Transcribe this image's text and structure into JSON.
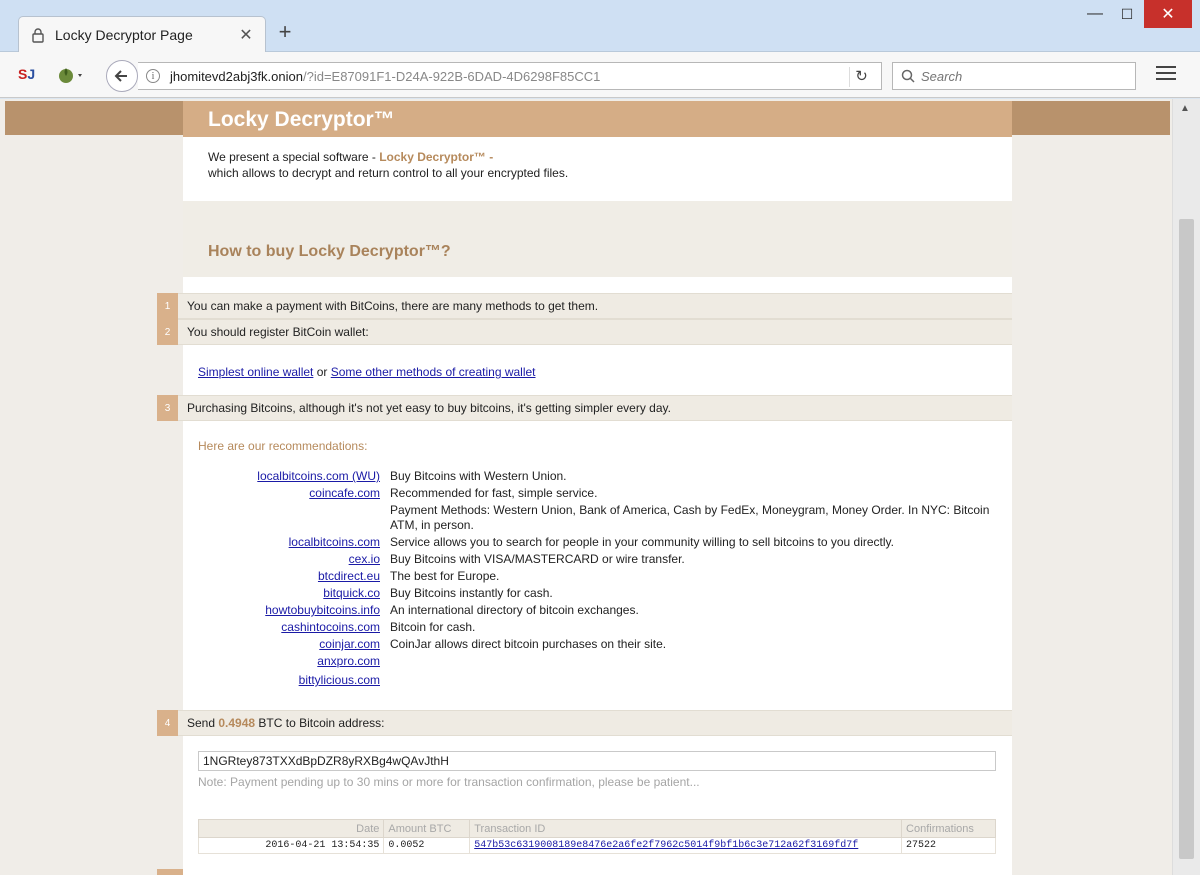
{
  "browser": {
    "tab_title": "Locky Decryptor Page",
    "tab_close": "✕",
    "new_tab": "+",
    "url_host": "jhomitevd2abj3fk.onion",
    "url_rest": "/?id=E87091F1-D24A-922B-6DAD-4D6298F85CC1",
    "search_placeholder": "Search",
    "ext_label_a": "S",
    "ext_label_b": "J",
    "info_glyph": "i",
    "reload_glyph": "↻",
    "window_min": "—",
    "window_max": "☐",
    "window_close": "✕",
    "colors": {
      "close_button": "#c7302b",
      "accent_brown": "#d5ad86",
      "link_blue": "#1a1aa6"
    }
  },
  "page": {
    "title": "Locky Decryptor™",
    "intro_prefix": "We present a special software - ",
    "intro_brand": "Locky Decryptor™ -",
    "intro_line2": "which allows to decrypt and return control to all your encrypted files.",
    "howto_title": "How to buy Locky Decryptor™?",
    "steps": [
      {
        "num": "1",
        "text": "You can make a payment with BitCoins, there are many methods to get them."
      },
      {
        "num": "2",
        "text": "You should register BitCoin wallet:"
      },
      {
        "num": "3",
        "text": "Purchasing Bitcoins, although it's not yet easy to buy bitcoins, it's getting simpler every day."
      },
      {
        "num": "4",
        "text_prefix": "Send ",
        "amount": "0.4948",
        "text_suffix": " BTC to Bitcoin address:"
      }
    ],
    "wallet_link_1": "Simplest online wallet",
    "wallet_or": " or ",
    "wallet_link_2": "Some other methods of creating wallet",
    "reco_label": "Here are our recommendations:",
    "recommendations": [
      {
        "site": "localbitcoins.com (WU)",
        "desc": "Buy Bitcoins with Western Union."
      },
      {
        "site": "coincafe.com",
        "desc": "Recommended for fast, simple service."
      },
      {
        "site": "",
        "desc": "Payment Methods: Western Union, Bank of America, Cash by FedEx, Moneygram, Money Order. In NYC: Bitcoin ATM, in person."
      },
      {
        "site": "localbitcoins.com",
        "desc": "Service allows you to search for people in your community willing to sell bitcoins to you directly."
      },
      {
        "site": "cex.io",
        "desc": "Buy Bitcoins with VISA/MASTERCARD or wire transfer."
      },
      {
        "site": "btcdirect.eu",
        "desc": "The best for Europe."
      },
      {
        "site": "bitquick.co",
        "desc": "Buy Bitcoins instantly for cash."
      },
      {
        "site": "howtobuybitcoins.info",
        "desc": "An international directory of bitcoin exchanges."
      },
      {
        "site": "cashintocoins.com",
        "desc": "Bitcoin for cash."
      },
      {
        "site": "coinjar.com",
        "desc": "CoinJar allows direct bitcoin purchases on their site."
      },
      {
        "site": "anxpro.com",
        "desc": ""
      },
      {
        "site": "bittylicious.com",
        "desc": ""
      }
    ],
    "btc_address": "1NGRtey873TXXdBpDZR8yRXBg4wQAvJthH",
    "note": "Note: Payment pending up to 30 mins or more for transaction confirmation, please be patient...",
    "tx_headers": {
      "date": "Date",
      "amount": "Amount BTC",
      "tx_id": "Transaction ID",
      "confirmations": "Confirmations"
    },
    "transactions": [
      {
        "date": "2016-04-21 13:54:35",
        "amount": "0.0052",
        "tx_id": "547b53c6319008189e8476e2a6fe2f7962c5014f9bf1b6c3e712a62f3169fd7f",
        "confirmations": "27522"
      }
    ]
  }
}
